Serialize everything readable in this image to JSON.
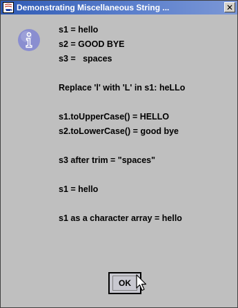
{
  "window": {
    "title": "Demonstrating Miscellaneous String ...",
    "close_glyph": "✕"
  },
  "icons": {
    "app": "java-app-icon",
    "message": "information-icon",
    "cursor": "mouse-pointer-icon"
  },
  "message": {
    "lines": [
      "s1 = hello",
      "s2 = GOOD BYE",
      "s3 =   spaces",
      "",
      "Replace 'l' with 'L' in s1: heLLo",
      "",
      "s1.toUpperCase() = HELLO",
      "s2.toLowerCase() = good bye",
      "",
      "s3 after trim = \"spaces\"",
      "",
      "s1 = hello",
      "",
      "s1 as a character array = hello"
    ]
  },
  "buttons": {
    "ok_label": "OK"
  },
  "colors": {
    "titlebar_start": "#2f5bb5",
    "titlebar_end": "#7b97d6",
    "dialog_background": "#bfbfbf",
    "info_icon": "#8a8ed0"
  }
}
